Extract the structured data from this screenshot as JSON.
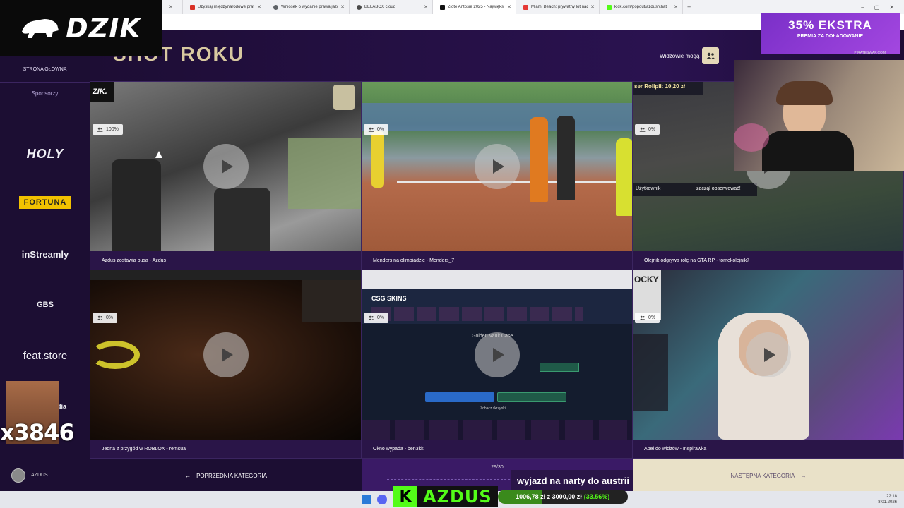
{
  "browser": {
    "tabs": [
      {
        "title": "",
        "active": false,
        "favicon_color": "#888888"
      },
      {
        "title": "Uzyskaj międzynarodowe praw",
        "active": false,
        "favicon_color": "#d93025"
      },
      {
        "title": "Wniosek o wydanie prawa jazd",
        "active": false,
        "favicon_color": "#5f6368"
      },
      {
        "title": "BELABOX cloud",
        "active": false,
        "favicon_color": "#4a4a4a"
      },
      {
        "title": "Złote Antosie 2025 - Największ",
        "active": true,
        "favicon_color": "#111111"
      },
      {
        "title": "Miami Beach: prywatny lot nad",
        "active": false,
        "favicon_color": "#e53935"
      },
      {
        "title": "kick.com/popout/azdus/chat",
        "active": false,
        "favicon_color": "#53fc18"
      }
    ],
    "new_tab": "+",
    "window_controls": [
      "–",
      "▢",
      "✕"
    ]
  },
  "logo": {
    "text": "DZIK",
    "icon": "boar-icon"
  },
  "sidebar": {
    "home": "STRONA GŁÓWNA",
    "sponsors_label": "Sponsorzy",
    "sponsors": [
      "HOLY",
      "FORTUNA",
      "inStreamly",
      "GBS",
      "feat.store",
      "edia"
    ],
    "user": "AZDUS"
  },
  "header": {
    "title": "SHOT ROKU",
    "visible_label": "Widzowie mogą",
    "visible_icon": "users-icon"
  },
  "cards": [
    {
      "title": "Azdus zostawia busa - Azdus",
      "percent": "100%"
    },
    {
      "title": "Menders na olimpiadzie - Menders_7",
      "percent": "0%"
    },
    {
      "title": "Olejnik odgrywa rolę na GTA RP - tomekolejnik7",
      "percent": "0%"
    },
    {
      "title": "Jedna z przygód w ROBLOX - remsua",
      "percent": "0%"
    },
    {
      "title": "Okno wypada - ben3kk",
      "percent": "0%"
    },
    {
      "title": "Apel do widzów - Inspirawka",
      "percent": "0%"
    }
  ],
  "card_overlays": {
    "card1_logo": "ZIK.",
    "card3_top": "ser Rollpii: 10,20 zł",
    "card3_follow": "Użytkownik",
    "card3_follow_text": "zaczął obserwować!",
    "card5_header": "CSG SKINS",
    "card5_case": "Golden Vault Case",
    "card5_button": "Sprzedaj wszystko za 424,79 zł",
    "card5_open": "Zobacz skrzynki",
    "card6_tag": "OCKY"
  },
  "bottom_nav": {
    "prev": "POPRZEDNIA KATEGORIA",
    "counter": "29/30",
    "next": "NASTĘPNA KATEGORIA"
  },
  "ticker_text": "wyjazd na narty do austrii",
  "promo": {
    "big": "35% EKSTRA",
    "small": "PREMIA ZA DOŁADOWANIE",
    "source": "PIRATESWAP.COM"
  },
  "donation": {
    "platform_letter": "K",
    "name": "AZDUS",
    "current": "1006,78 zł",
    "separator": "z",
    "goal": "3000,00 zł",
    "percent": "(33.56%)",
    "progress": 0.3356
  },
  "counter_overlay": "x3846",
  "taskbar": {
    "time": "22:18",
    "date": "8.01.2026"
  },
  "colors": {
    "accent_purple": "#2a1548",
    "gold": "#d8c9a0",
    "kick_green": "#53fc18"
  }
}
